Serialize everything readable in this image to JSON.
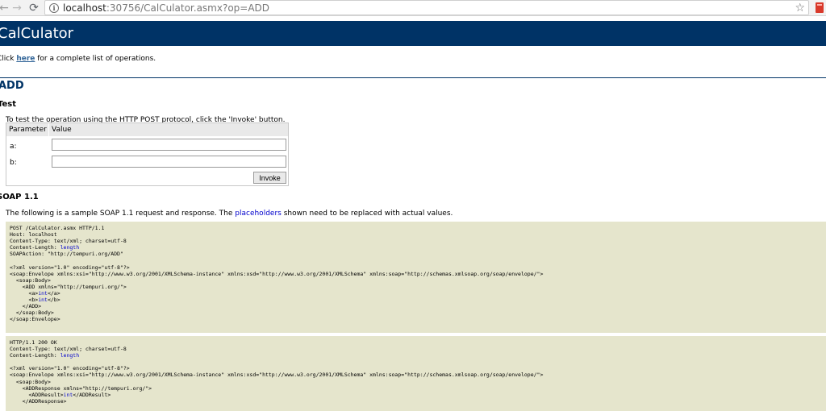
{
  "browser": {
    "url_host": "localhost",
    "url_rest": ":30756/CalCulator.asmx?op=ADD",
    "icons": {
      "back": "back-arrow-icon",
      "forward": "forward-arrow-icon",
      "reload": "reload-icon",
      "info": "info-icon",
      "bookmark": "star-icon",
      "extension": "extension-icon"
    }
  },
  "page": {
    "banner_title": "CalCulator",
    "intro_before": "Click ",
    "intro_link": "here",
    "intro_after": " for a complete list of operations.",
    "operation_heading": "ADD",
    "test_heading": "Test",
    "test_intro": "To test the operation using the HTTP POST protocol, click the 'Invoke' button.",
    "form": {
      "col_parameter": "Parameter",
      "col_value": "Value",
      "params": [
        {
          "label": "a:",
          "value": ""
        },
        {
          "label": "b:",
          "value": ""
        }
      ],
      "invoke_label": "Invoke"
    },
    "soap_heading": "SOAP 1.1",
    "soap_intro_before": "The following is a sample SOAP 1.1 request and response.  The ",
    "soap_intro_link": "placeholders",
    "soap_intro_after": " shown need to be replaced with actual values.",
    "colors": {
      "banner": "#003366",
      "code_bg": "#e5e5cc",
      "placeholder": "#0000cc",
      "link": "#336699"
    }
  },
  "request_sample": [
    [
      [
        "POST /CalCulator.asmx HTTP/1.1",
        false
      ]
    ],
    [
      [
        "Host: localhost",
        false
      ]
    ],
    [
      [
        "Content-Type: text/xml; charset=utf-8",
        false
      ]
    ],
    [
      [
        "Content-Length: ",
        false
      ],
      [
        "length",
        true
      ]
    ],
    [
      [
        "SOAPAction: \"http://tempuri.org/ADD\"",
        false
      ]
    ],
    [
      [
        "",
        false
      ]
    ],
    [
      [
        "<?xml version=\"1.0\" encoding=\"utf-8\"?>",
        false
      ]
    ],
    [
      [
        "<soap:Envelope xmlns:xsi=\"http://www.w3.org/2001/XMLSchema-instance\" xmlns:xsd=\"http://www.w3.org/2001/XMLSchema\" xmlns:soap=\"http://schemas.xmlsoap.org/soap/envelope/\">",
        false
      ]
    ],
    [
      [
        "  <soap:Body>",
        false
      ]
    ],
    [
      [
        "    <ADD xmlns=\"http://tempuri.org/\">",
        false
      ]
    ],
    [
      [
        "      <a>",
        false
      ],
      [
        "int",
        true
      ],
      [
        "</a>",
        false
      ]
    ],
    [
      [
        "      <b>",
        false
      ],
      [
        "int",
        true
      ],
      [
        "</b>",
        false
      ]
    ],
    [
      [
        "    </ADD>",
        false
      ]
    ],
    [
      [
        "  </soap:Body>",
        false
      ]
    ],
    [
      [
        "</soap:Envelope>",
        false
      ]
    ]
  ],
  "response_sample": [
    [
      [
        "HTTP/1.1 200 OK",
        false
      ]
    ],
    [
      [
        "Content-Type: text/xml; charset=utf-8",
        false
      ]
    ],
    [
      [
        "Content-Length: ",
        false
      ],
      [
        "length",
        true
      ]
    ],
    [
      [
        "",
        false
      ]
    ],
    [
      [
        "<?xml version=\"1.0\" encoding=\"utf-8\"?>",
        false
      ]
    ],
    [
      [
        "<soap:Envelope xmlns:xsi=\"http://www.w3.org/2001/XMLSchema-instance\" xmlns:xsd=\"http://www.w3.org/2001/XMLSchema\" xmlns:soap=\"http://schemas.xmlsoap.org/soap/envelope/\">",
        false
      ]
    ],
    [
      [
        "  <soap:Body>",
        false
      ]
    ],
    [
      [
        "    <ADDResponse xmlns=\"http://tempuri.org/\">",
        false
      ]
    ],
    [
      [
        "      <ADDResult>",
        false
      ],
      [
        "int",
        true
      ],
      [
        "</ADDResult>",
        false
      ]
    ],
    [
      [
        "    </ADDResponse>",
        false
      ]
    ]
  ]
}
